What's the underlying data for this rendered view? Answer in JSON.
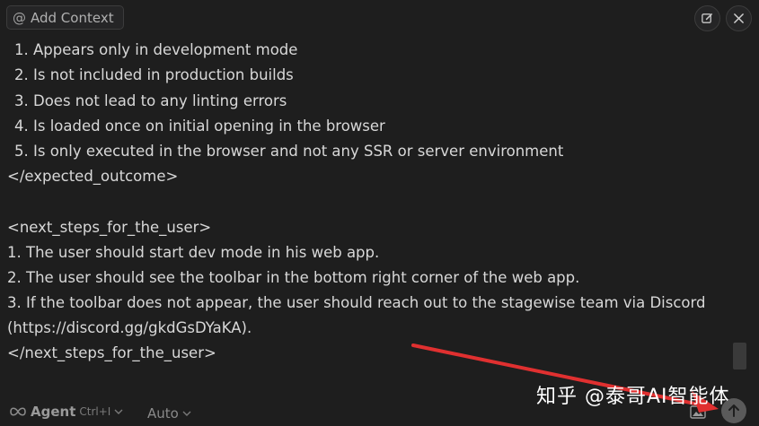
{
  "header": {
    "add_context_label": "Add Context",
    "at_symbol": "@",
    "edit_icon": "edit-icon",
    "close_icon": "close-icon"
  },
  "content": {
    "outcome_items": [
      "1. Appears only in development mode",
      "2. Is not included in production builds",
      "3. Does not lead to any linting errors",
      "4. Is loaded once on initial opening in the browser",
      "5. Is only executed in the browser and not any SSR or server environment"
    ],
    "outcome_close_tag": "</expected_outcome>",
    "next_steps_open_tag": "<next_steps_for_the_user>",
    "next_steps": [
      "1. The user should start dev mode in his web app.",
      "2. The user should see the toolbar in the bottom right corner of the web app.",
      "3. If the toolbar does not appear, the user should reach out to the stagewise team via Discord",
      "(https://discord.gg/gkdGsDYaKA)."
    ],
    "next_steps_close_tag": "</next_steps_for_the_user>"
  },
  "footer": {
    "mode_label": "Agent",
    "mode_shortcut": "Ctrl+I",
    "model_label": "Auto",
    "image_icon": "image-icon",
    "send_icon": "arrow-up-icon"
  },
  "watermark": {
    "text": "知乎 @泰哥AI智能体"
  },
  "colors": {
    "background": "#1e1e1e",
    "text": "#d8d8d8",
    "annotation_arrow": "#e03030"
  }
}
